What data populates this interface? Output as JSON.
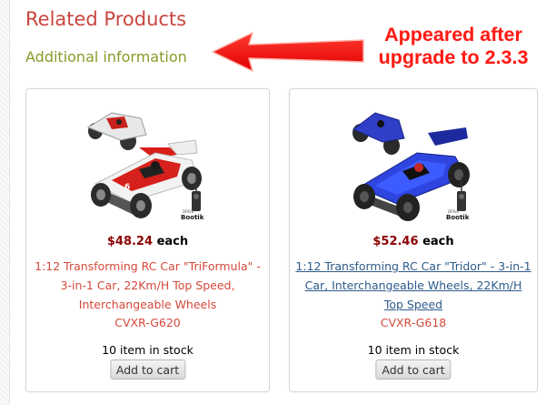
{
  "section": {
    "title": "Related Products",
    "subtitle": "Additional information"
  },
  "annotation": {
    "line1": "Appeared after",
    "line2": "upgrade to 2.3.3",
    "color": "#ff1a14"
  },
  "products": [
    {
      "image_icon": "rc-car-red-white-image",
      "brand_mark": "Bootik",
      "price": "$48.24",
      "price_suffix": "each",
      "name": "1:12 Transforming RC Car \"TriFormula\" - 3-in-1 Car, 22Km/H Top Speed, Interchangeable Wheels",
      "sku": "CVXR-G620",
      "stock": "10 item in stock",
      "button": "Add to cart",
      "link_color": "#d4493b"
    },
    {
      "image_icon": "rc-car-blue-image",
      "brand_mark": "Bootik",
      "price": "$52.46",
      "price_suffix": "each",
      "name": "1:12 Transforming RC Car \"Tridor\" - 3-in-1 Car, Interchangeable Wheels, 22Km/H Top Speed",
      "sku": "CVXR-G618",
      "stock": "10 item in stock",
      "button": "Add to cart",
      "link_color": "#2e5b8a"
    }
  ]
}
